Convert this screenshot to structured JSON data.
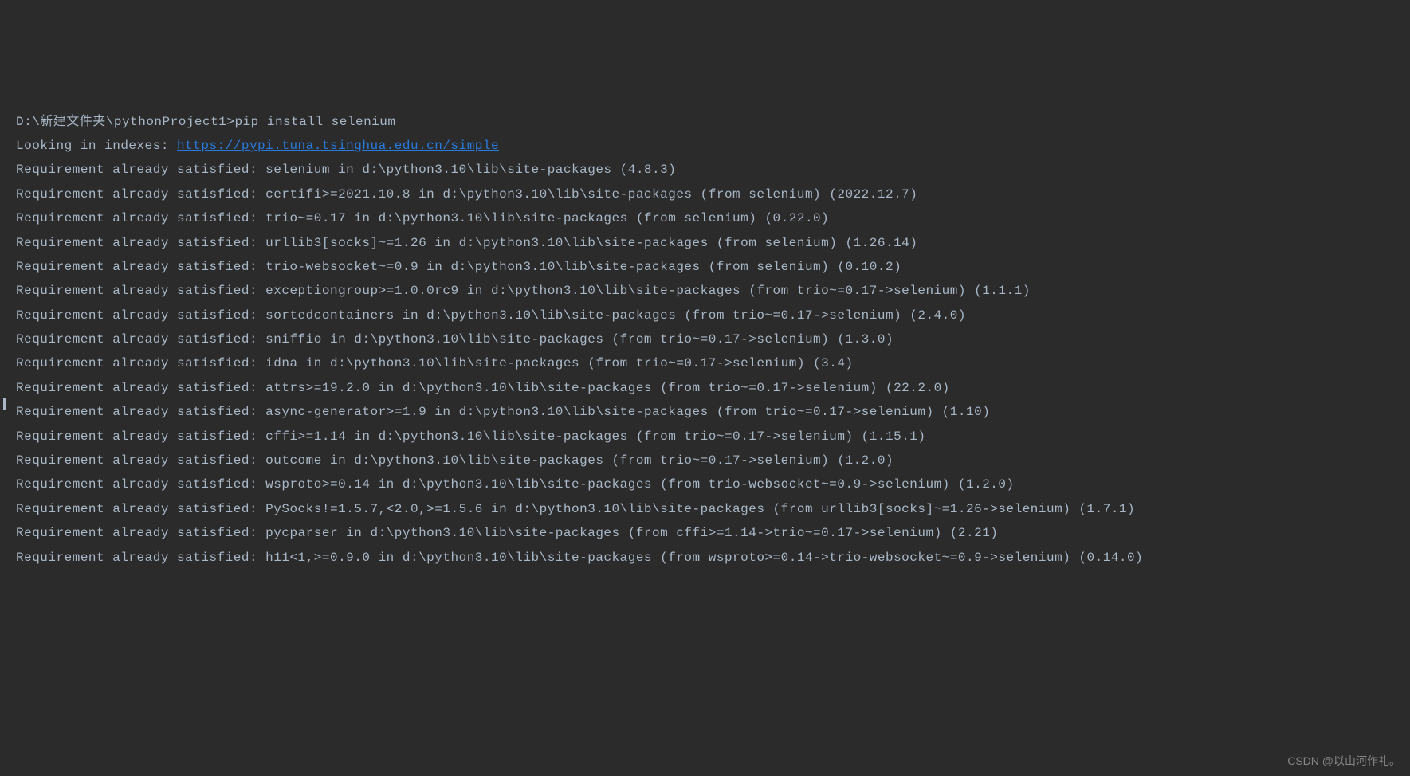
{
  "prompt": {
    "path": "D:\\新建文件夹\\pythonProject1>",
    "command": "pip install selenium"
  },
  "indexes_prefix": "Looking in indexes: ",
  "indexes_url": "https://pypi.tuna.tsinghua.edu.cn/simple",
  "lines": [
    "Requirement already satisfied: selenium in d:\\python3.10\\lib\\site-packages (4.8.3)",
    "Requirement already satisfied: certifi>=2021.10.8 in d:\\python3.10\\lib\\site-packages (from selenium) (2022.12.7)",
    "Requirement already satisfied: trio~=0.17 in d:\\python3.10\\lib\\site-packages (from selenium) (0.22.0)",
    "Requirement already satisfied: urllib3[socks]~=1.26 in d:\\python3.10\\lib\\site-packages (from selenium) (1.26.14)",
    "Requirement already satisfied: trio-websocket~=0.9 in d:\\python3.10\\lib\\site-packages (from selenium) (0.10.2)",
    "Requirement already satisfied: exceptiongroup>=1.0.0rc9 in d:\\python3.10\\lib\\site-packages (from trio~=0.17->selenium) (1.1.1)",
    "Requirement already satisfied: sortedcontainers in d:\\python3.10\\lib\\site-packages (from trio~=0.17->selenium) (2.4.0)",
    "Requirement already satisfied: sniffio in d:\\python3.10\\lib\\site-packages (from trio~=0.17->selenium) (1.3.0)",
    "Requirement already satisfied: idna in d:\\python3.10\\lib\\site-packages (from trio~=0.17->selenium) (3.4)",
    "Requirement already satisfied: attrs>=19.2.0 in d:\\python3.10\\lib\\site-packages (from trio~=0.17->selenium) (22.2.0)",
    "Requirement already satisfied: async-generator>=1.9 in d:\\python3.10\\lib\\site-packages (from trio~=0.17->selenium) (1.10)",
    "Requirement already satisfied: cffi>=1.14 in d:\\python3.10\\lib\\site-packages (from trio~=0.17->selenium) (1.15.1)",
    "Requirement already satisfied: outcome in d:\\python3.10\\lib\\site-packages (from trio~=0.17->selenium) (1.2.0)",
    "Requirement already satisfied: wsproto>=0.14 in d:\\python3.10\\lib\\site-packages (from trio-websocket~=0.9->selenium) (1.2.0)",
    "Requirement already satisfied: PySocks!=1.5.7,<2.0,>=1.5.6 in d:\\python3.10\\lib\\site-packages (from urllib3[socks]~=1.26->selenium) (1.7.1)",
    "Requirement already satisfied: pycparser in d:\\python3.10\\lib\\site-packages (from cffi>=1.14->trio~=0.17->selenium) (2.21)",
    "Requirement already satisfied: h11<1,>=0.9.0 in d:\\python3.10\\lib\\site-packages (from wsproto>=0.14->trio-websocket~=0.9->selenium) (0.14.0)"
  ],
  "watermark": "CSDN @以山河作礼。"
}
